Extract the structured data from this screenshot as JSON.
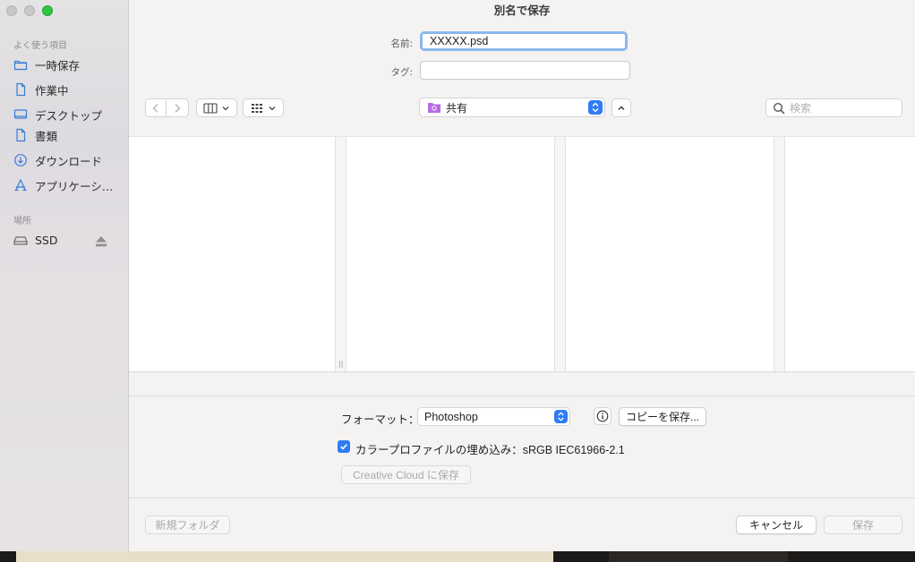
{
  "window": {
    "title": "別名で保存"
  },
  "sidebar": {
    "favorites_label": "よく使う項目",
    "favorites": [
      {
        "label": "一時保存",
        "icon": "folder-icon"
      },
      {
        "label": "作業中",
        "icon": "document-icon"
      },
      {
        "label": "デスクトップ",
        "icon": "desktop-icon"
      },
      {
        "label": "書類",
        "icon": "document-icon"
      },
      {
        "label": "ダウンロード",
        "icon": "download-icon"
      },
      {
        "label": "アプリケーシ…",
        "icon": "applications-icon"
      }
    ],
    "locations_label": "場所",
    "locations": [
      {
        "label": "SSD",
        "icon": "drive-icon"
      }
    ]
  },
  "form": {
    "name_label": "名前:",
    "name_value": "XXXXX.psd",
    "tag_label": "タグ:",
    "tag_value": ""
  },
  "toolbar": {
    "location": "共有",
    "search_placeholder": "検索"
  },
  "options": {
    "format_label": "フォーマット：",
    "format_value": "Photoshop",
    "save_copy_label": "コピーを保存...",
    "embed_profile_label": "カラープロファイルの埋め込み：sRGB IEC61966-2.1",
    "embed_profile_checked": true,
    "creative_cloud_label": "Creative Cloud に保存"
  },
  "footer": {
    "new_folder_label": "新規フォルダ",
    "cancel_label": "キャンセル",
    "save_label": "保存"
  },
  "colors": {
    "accent": "#2f7cf6",
    "focus_ring": "#8bb7ef",
    "sidebar_icon": "#3a7bd5"
  }
}
